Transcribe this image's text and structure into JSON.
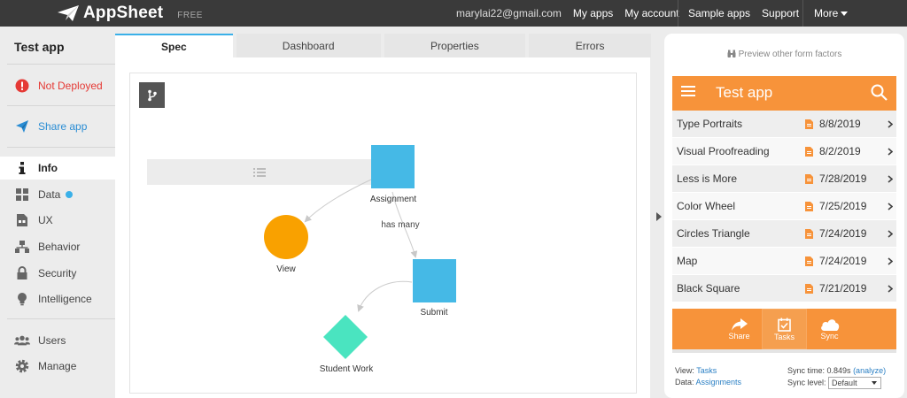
{
  "topbar": {
    "brand": "AppSheet",
    "tier": "FREE",
    "email": "marylai22@gmail.com",
    "my_apps": "My apps",
    "my_account": "My account",
    "sample_apps": "Sample apps",
    "support": "Support",
    "more": "More"
  },
  "sidebar": {
    "app_name": "Test app",
    "status": "Not Deployed",
    "share": "Share app",
    "items": [
      {
        "label": "Info",
        "icon": "info-icon",
        "active": true
      },
      {
        "label": "Data",
        "icon": "data-grid-icon",
        "badge": true
      },
      {
        "label": "UX",
        "icon": "ux-icon"
      },
      {
        "label": "Behavior",
        "icon": "behavior-icon"
      },
      {
        "label": "Security",
        "icon": "lock-icon"
      },
      {
        "label": "Intelligence",
        "icon": "lightbulb-icon"
      }
    ],
    "users": "Users",
    "manage": "Manage",
    "colors": {
      "status_red": "#e53935",
      "share_blue": "#2a8dd4",
      "badge": "#3ab0e8"
    }
  },
  "tabs": [
    "Spec",
    "Dashboard",
    "Properties",
    "Errors"
  ],
  "active_tab": "Spec",
  "graph": {
    "nodes": [
      {
        "label": "Assignment",
        "shape": "square",
        "color": "#45b9e6"
      },
      {
        "label": "View",
        "shape": "circle",
        "color": "#f9a100"
      },
      {
        "label": "Submit",
        "shape": "square",
        "color": "#45b9e6"
      },
      {
        "label": "Student Work",
        "shape": "diamond",
        "color": "#4ae4c0"
      }
    ],
    "edge_label": "has many"
  },
  "preview": {
    "form_factors": "Preview other form factors",
    "app_title": "Test app",
    "accent": "#f7933a",
    "rows": [
      {
        "name": "Type Portraits",
        "date": "8/8/2019"
      },
      {
        "name": "Visual Proofreading",
        "date": "8/2/2019"
      },
      {
        "name": "Less is More",
        "date": "7/28/2019"
      },
      {
        "name": "Color Wheel",
        "date": "7/25/2019"
      },
      {
        "name": "Circles Triangle",
        "date": "7/24/2019"
      },
      {
        "name": "Map",
        "date": "7/24/2019"
      },
      {
        "name": "Black Square",
        "date": "7/21/2019"
      }
    ],
    "nav": [
      {
        "label": "Share",
        "icon": "share-arrow-icon"
      },
      {
        "label": "Tasks",
        "icon": "calendar-check-icon",
        "active": true
      },
      {
        "label": "Sync",
        "icon": "cloud-icon"
      }
    ],
    "view_label": "View:",
    "view_value": "Tasks",
    "data_label": "Data:",
    "data_value": "Assignments",
    "sync_time_label": "Sync time: 0.849s",
    "analyze": "(analyze)",
    "sync_level_label": "Sync level:",
    "sync_level_value": "Default"
  }
}
